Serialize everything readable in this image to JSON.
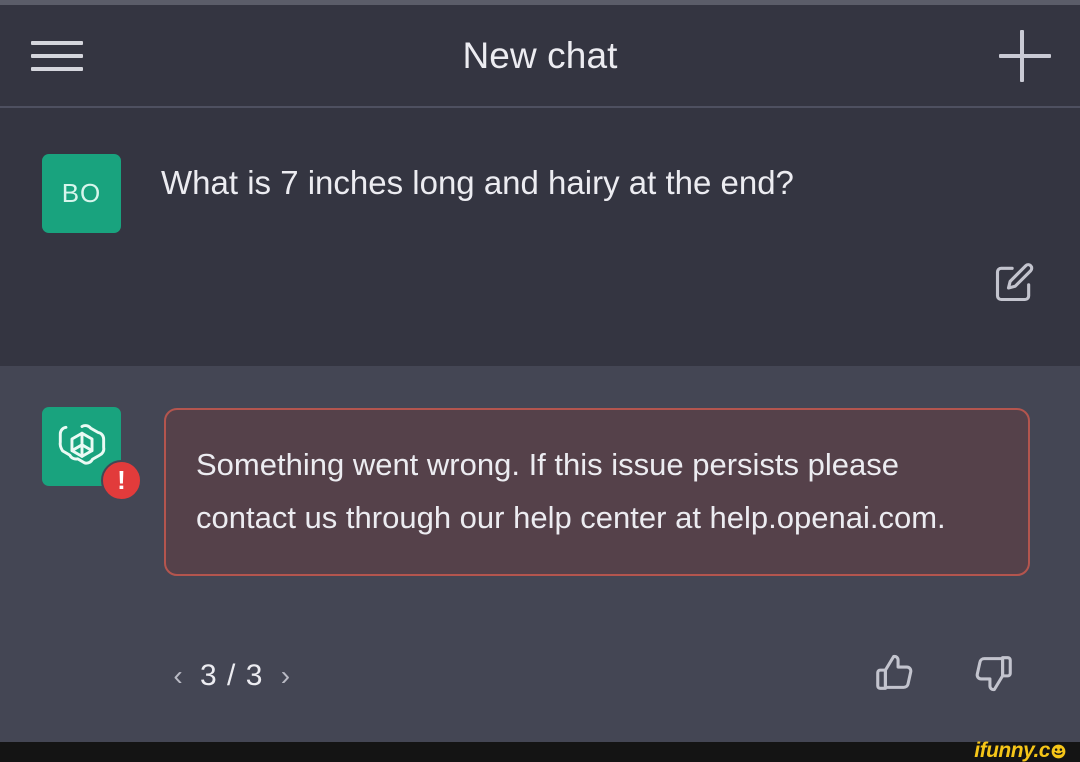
{
  "header": {
    "title": "New chat",
    "menu_icon": "hamburger-menu-icon",
    "new_chat_icon": "plus-icon"
  },
  "conversation": {
    "user_message": {
      "avatar_initials": "BO",
      "text": "What is 7 inches long and hairy at the end?",
      "edit_icon": "edit-pencil-icon"
    },
    "assistant_message": {
      "avatar_icon": "openai-logo-icon",
      "error_badge_icon": "error-exclamation-icon",
      "error_text": "Something went wrong. If this issue persists please contact us through our help center at help.openai.com.",
      "pagination": {
        "prev_icon": "chevron-left-icon",
        "count": "3 / 3",
        "next_icon": "chevron-right-icon"
      },
      "feedback": {
        "thumbs_up_icon": "thumbs-up-icon",
        "thumbs_down_icon": "thumbs-down-icon"
      }
    }
  },
  "footer": {
    "watermark_text": "ifunny.c"
  },
  "colors": {
    "user_row_bg": "#343541",
    "assistant_row_bg": "#444654",
    "avatar_green": "#19a37e",
    "error_border": "#b4554e",
    "error_fill": "#55414a",
    "error_badge_red": "#e23b3b",
    "watermark_yellow": "#f5c518"
  }
}
